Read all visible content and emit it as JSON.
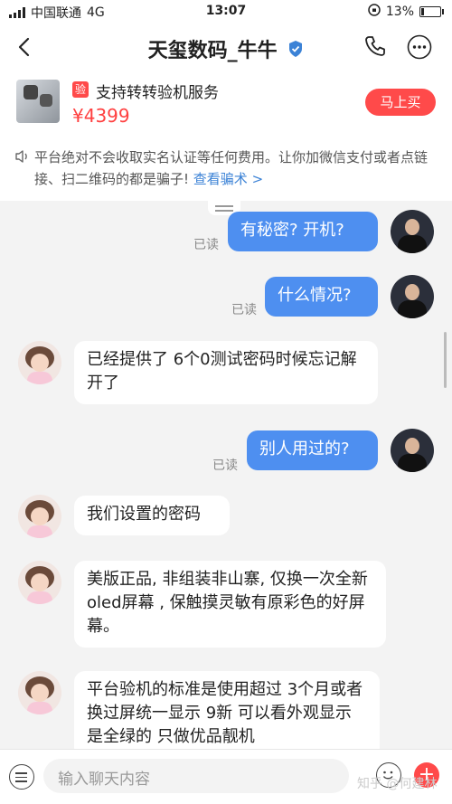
{
  "status_bar": {
    "carrier": "中国联通",
    "network": "4G",
    "time": "13:07",
    "battery": "13%",
    "battery_level": 0.13
  },
  "header": {
    "title": "天玺数码_牛牛"
  },
  "product": {
    "service_badge": "验",
    "title": "支持转转验机服务",
    "price": "¥4399",
    "buy_label": "马上买"
  },
  "notice": {
    "text": "平台绝对不会收取实名认证等任何费用。让你加微信支付或者点链接、扫二维码的都是骗子!",
    "link": "查看骗术 >"
  },
  "messages": [
    {
      "side": "out",
      "text": "有秘密? 开机?",
      "status": "已读"
    },
    {
      "side": "out",
      "text": "什么情况?",
      "status": "已读"
    },
    {
      "side": "in",
      "text": "已经提供了 6个0测试密码时候忘记解开了"
    },
    {
      "side": "out",
      "text": "别人用过的?",
      "status": "已读"
    },
    {
      "side": "in",
      "text": "我们设置的密码"
    },
    {
      "side": "in",
      "text": "美版正品, 非组装非山寨, 仅换一次全新oled屏幕 , 保触摸灵敏有原彩色的好屏幕。"
    },
    {
      "side": "in",
      "text": "平台验机的标准是使用超过 3个月或者换过屏统一显示 9新 可以看外观显示是全绿的 只做优品靓机"
    }
  ],
  "input": {
    "placeholder": "输入聊天内容"
  },
  "watermark": "知乎 @何建林",
  "colors": {
    "accent": "#ff4a4a",
    "bubble_out": "#4e8ff0",
    "link": "#3b82d6"
  }
}
